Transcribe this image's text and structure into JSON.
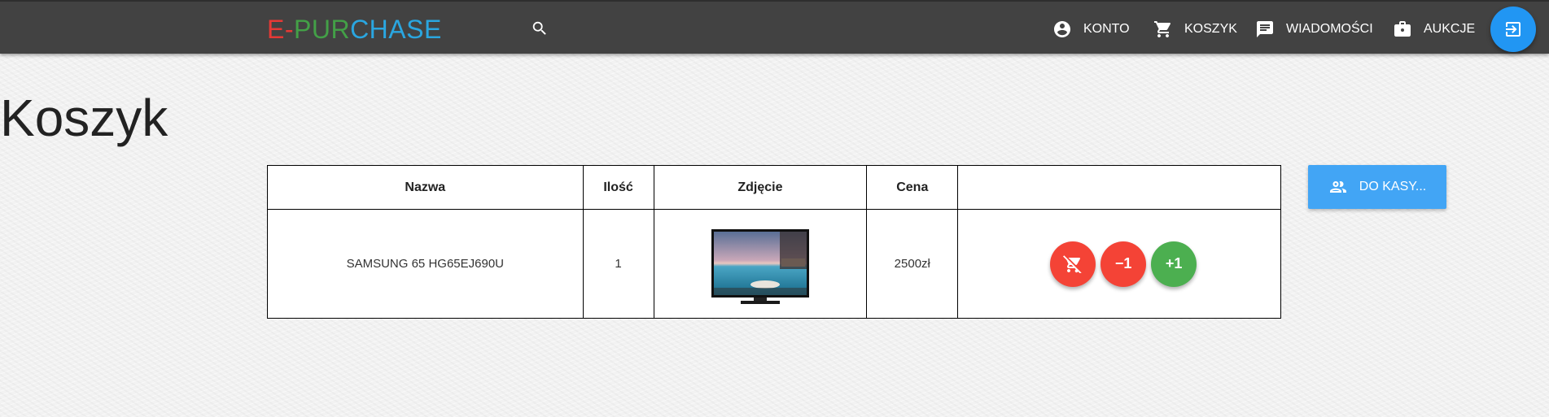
{
  "navbar": {
    "logo": {
      "part1": "E-",
      "part2": "PUR",
      "part3": "CHASE"
    },
    "logo_colors": [
      "#e53935",
      "#43a047",
      "#2aa6e0"
    ],
    "search_icon": "search-icon",
    "items": [
      {
        "label": "KONTO",
        "icon": "account-circle-icon"
      },
      {
        "label": "KOSZYK",
        "icon": "shopping-cart-icon"
      },
      {
        "label": "WIADOMOŚCI",
        "icon": "message-icon"
      },
      {
        "label": "AUKCJE",
        "icon": "briefcase-icon"
      }
    ],
    "login_icon": "login-icon",
    "background": "#424242",
    "accent": "#2196f3"
  },
  "page": {
    "title": "Koszyk"
  },
  "cart": {
    "headers": [
      "Nazwa",
      "Ilość",
      "Zdjęcie",
      "Cena",
      ""
    ],
    "rows": [
      {
        "name": "SAMSUNG 65 HG65EJ690U",
        "qty": "1",
        "image": "tv-image",
        "price": "2500zł",
        "actions": {
          "remove_icon": "remove-shopping-cart-icon",
          "minus_label": "−1",
          "plus_label": "+1"
        }
      }
    ],
    "colors": {
      "remove": "#f44336",
      "minus": "#f44336",
      "plus": "#4caf50"
    }
  },
  "checkout": {
    "label": "DO KASY...",
    "icon": "people-icon",
    "color": "#42a5f5"
  }
}
